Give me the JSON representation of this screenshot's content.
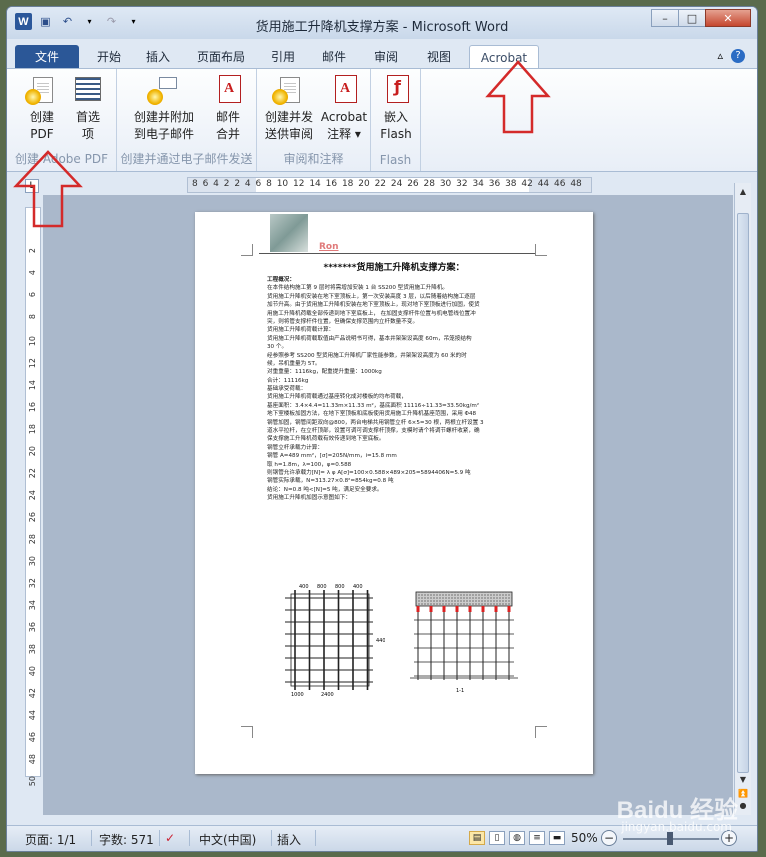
{
  "window": {
    "title": "货用施工升降机支撑方案 - Microsoft Word",
    "logo": "W"
  },
  "tabs": [
    {
      "label": "文件"
    },
    {
      "label": "开始"
    },
    {
      "label": "插入"
    },
    {
      "label": "页面布局"
    },
    {
      "label": "引用"
    },
    {
      "label": "邮件"
    },
    {
      "label": "审阅"
    },
    {
      "label": "视图"
    },
    {
      "label": "Acrobat"
    }
  ],
  "ribbon": {
    "group1": {
      "label": "创建 Adobe PDF",
      "btn1": [
        "创建",
        "PDF"
      ],
      "btn2": [
        "首选",
        "项"
      ]
    },
    "group2": {
      "label": "创建并通过电子邮件发送",
      "btn1": [
        "创建并附加",
        "到电子邮件"
      ],
      "btn2": [
        "邮件",
        "合并"
      ]
    },
    "group3": {
      "label": "审阅和注释",
      "btn1": [
        "创建并发",
        "送供审阅"
      ],
      "btn2": [
        "Acrobat",
        "注释 ▾"
      ]
    },
    "group4": {
      "label": "Flash",
      "btn1": [
        "嵌入",
        "Flash"
      ]
    }
  },
  "ruler": {
    "numbers": "8  6  4  2  2  4  6  8  10 12 14 16 18 20 22 24 26 28 30 32 34 36 38  42 44 46 48",
    "vertical": [
      "2",
      "4",
      "6",
      "8",
      "10",
      "12",
      "14",
      "16",
      "18",
      "20",
      "22",
      "24",
      "26",
      "28",
      "30",
      "32",
      "34",
      "36",
      "38",
      "40",
      "42",
      "44",
      "46",
      "48",
      "50"
    ]
  },
  "document": {
    "header_name": "Ron",
    "title": "*******货用施工升降机支撑方案：",
    "lines": [
      {
        "t": "工程概况：",
        "h": true
      },
      {
        "t": "    在本件结构施工第 9 层时将需增加安装 1 台 SS200 型货用施工升降机。",
        "h": false
      },
      {
        "t": "    货用施工升降机安装在地下室顶板上，第一次安装高度 3 层，以后随着结构施工逐层",
        "h": false
      },
      {
        "t": "加节升高。由于货用施工升降机安装在地下室顶板上，现对地下室顶板进行加固，使货",
        "h": false
      },
      {
        "t": "用施工升降机荷载全部传递到地下室底板上，  在加固支撑杆件位置与机电管线位置冲",
        "h": false
      },
      {
        "t": "突，则将管支撑杆件位置，但确保支撑范围内立杆数量不变。",
        "h": false
      },
      {
        "t": "    货用施工升降机荷载计算：",
        "h": false
      },
      {
        "t": "    货用施工升降机荷载取值由产品说明书可得，基本井架架设高度 60m，吊笼按结构",
        "h": false
      },
      {
        "t": "30 个。",
        "h": false
      },
      {
        "t": "    经参照参考 SS200 型货用施工升降机厂家性能参数，井架架设高度为 60 米的时",
        "h": false
      },
      {
        "t": "候，吊机重量为 5T。",
        "h": false
      },
      {
        "t": "    对重重量：1116kg，配重提升重量：1000kg",
        "h": false
      },
      {
        "t": "    合计：11116kg",
        "h": false
      },
      {
        "t": "    基础承受荷载：",
        "h": false
      },
      {
        "t": "    货用施工升降机荷载通过基座转化成对楼板的均布荷载，",
        "h": false
      },
      {
        "t": "    基座面积：3.4×4.4=11.33m×11.33 m²，基底面积 11116÷11.33=33.50kg/m²",
        "h": false
      },
      {
        "t": "    地下室楼板加固方法，在地下室顶板和底板使用货用施工升降机基座范围，采用 Φ48",
        "h": false
      },
      {
        "t": "钢管加固，钢管间距双向@800，两台电梯共用钢管立杆 6×5=30 根，两根立杆设置 3",
        "h": false
      },
      {
        "t": "道水平拉杆，在立杆顶部，设置可调可调支撑杆顶撑，支模时请个将调节螺杆收紧，确",
        "h": false
      },
      {
        "t": "保支撑施工升降机荷载有效传递到地下室底板。",
        "h": false
      },
      {
        "t": "    钢管立杆承载力计算：",
        "h": false
      },
      {
        "t": "    钢管 A=489 mm²，[σ]=205N/mm，i=15.8 mm",
        "h": false
      },
      {
        "t": "    取 h=1.8m，λ=100，φ=0.588",
        "h": false
      },
      {
        "t": "    则钢管允许承载力[N]= λ φ A[σ]=100×0.588×489×205=5894406N=5.9 吨",
        "h": false
      },
      {
        "t": "    钢管实际承载，N=313.27×0.8²=854kg=0.8 吨",
        "h": false
      },
      {
        "t": "    结论：N=0.8 吨<[N]=5 吨，满足安全要求。",
        "h": false
      },
      {
        "t": "    货用施工升降机加固示意图如下：",
        "h": false
      }
    ],
    "drawing_dims": [
      "400",
      "800",
      "800",
      "400",
      "1000",
      "2400",
      "4400",
      "1-1"
    ]
  },
  "status": {
    "page": "页面: 1/1",
    "words": "字数: 571",
    "lang": "中文(中国)",
    "mode": "插入",
    "zoom": "50%"
  },
  "watermark": {
    "brand": "Baidu 经验",
    "url": "jingyan.baidu.com"
  },
  "colors": {
    "file_tab": "#2b5797",
    "arrow": "#d42a2a",
    "ribbon_bg": "#f4f7fb"
  }
}
